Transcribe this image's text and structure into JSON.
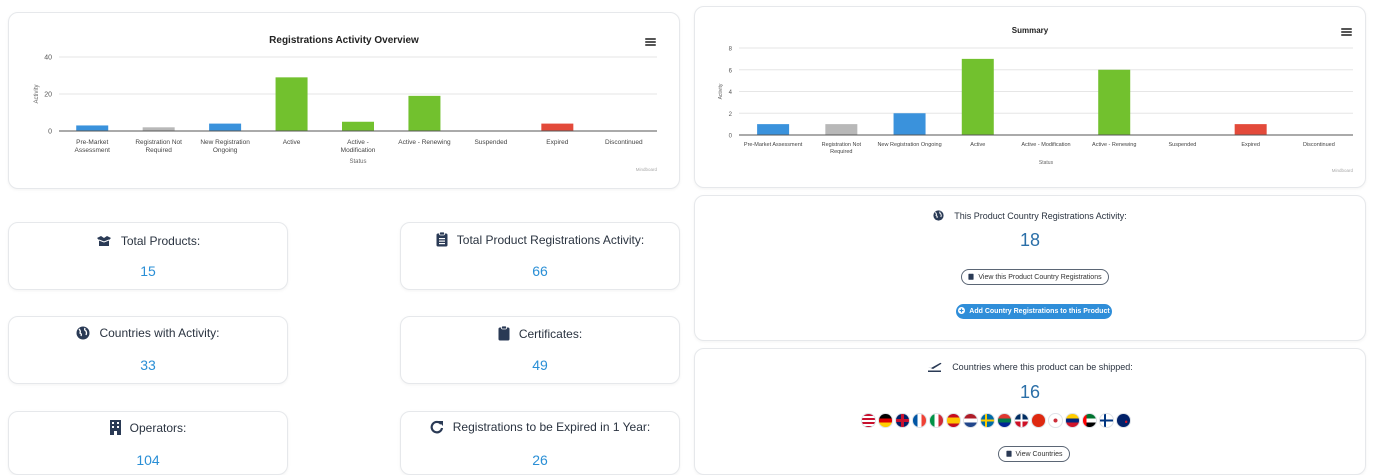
{
  "chart_data": [
    {
      "type": "bar",
      "title": "Registrations Activity Overview",
      "xlabel": "Status",
      "ylabel": "Activity",
      "ylim": [
        0,
        40
      ],
      "yticks": [
        "0",
        "20",
        "40"
      ],
      "grid": true,
      "credit": "Mindboard",
      "categories": [
        "Pre-Market Assessment",
        "Registration Not Required",
        "New Registration Ongoing",
        "Active",
        "Active - Modification",
        "Active - Renewing",
        "Suspended",
        "Expired",
        "Discontinued"
      ],
      "values": [
        3,
        2,
        4,
        29,
        5,
        19,
        0,
        4,
        0
      ],
      "colors": [
        "#3a92dc",
        "#b8b8b8",
        "#3a92dc",
        "#72c12e",
        "#72c12e",
        "#72c12e",
        "#72c12e",
        "#e34a3a",
        "#3a92dc"
      ]
    },
    {
      "type": "bar",
      "title": "Summary",
      "xlabel": "Status",
      "ylabel": "Activity",
      "ylim": [
        0,
        8
      ],
      "yticks": [
        "0",
        "2",
        "4",
        "6",
        "8"
      ],
      "grid": true,
      "credit": "Mindboard",
      "categories": [
        "Pre-Market Assessment",
        "Registration Not Required",
        "New Registration Ongoing",
        "Active",
        "Active - Modification",
        "Active - Renewing",
        "Suspended",
        "Expired",
        "Discontinued"
      ],
      "values": [
        1,
        1,
        2,
        7,
        0,
        6,
        0,
        1,
        0
      ],
      "colors": [
        "#3a92dc",
        "#b8b8b8",
        "#3a92dc",
        "#72c12e",
        "#72c12e",
        "#72c12e",
        "#72c12e",
        "#e34a3a",
        "#3a92dc"
      ]
    }
  ],
  "stats": {
    "total_products": {
      "label": "Total Products:",
      "value": "15",
      "icon": "boxes-icon"
    },
    "total_registrations": {
      "label": "Total Product Registrations Activity:",
      "value": "66",
      "icon": "clipboard-list-icon"
    },
    "countries_activity": {
      "label": "Countries with Activity:",
      "value": "33",
      "icon": "globe-icon"
    },
    "certificates": {
      "label": "Certificates:",
      "value": "49",
      "icon": "clipboard-icon"
    },
    "operators": {
      "label": "Operators:",
      "value": "104",
      "icon": "building-icon"
    },
    "expiring": {
      "label": "Registrations to be Expired in 1 Year:",
      "value": "26",
      "icon": "redo-icon"
    }
  },
  "product_country": {
    "label": "This Product Country Registrations Activity:",
    "value": "18",
    "view_button": "View this Product Country Registrations",
    "add_button": "Add Country Registrations to this Product"
  },
  "shipping": {
    "label": "Countries where this product can be shipped:",
    "value": "16",
    "view_button": "View Countries",
    "flags": [
      "United States",
      "Germany",
      "United Kingdom",
      "France",
      "Italy",
      "Spain",
      "Netherlands",
      "Sweden",
      "South Africa",
      "Dominican Republic",
      "China",
      "South Korea",
      "Venezuela",
      "United Arab Emirates",
      "Finland",
      "New Zealand"
    ]
  },
  "colors": {
    "accent": "#2a8fd6",
    "button": "#2f8ed9",
    "green": "#72c12e",
    "red": "#e34a3a",
    "gray": "#b8b8b8"
  }
}
